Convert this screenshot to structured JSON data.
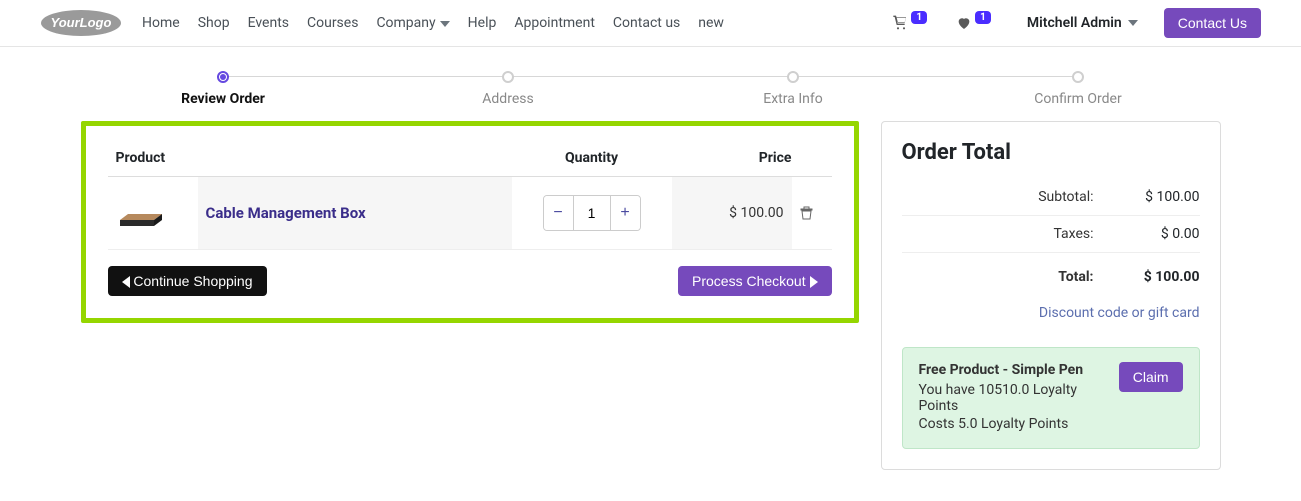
{
  "nav": {
    "items": [
      "Home",
      "Shop",
      "Events",
      "Courses",
      "Company",
      "Help",
      "Appointment",
      "Contact us",
      "new"
    ],
    "dropdown_index": 4,
    "cart_badge": "1",
    "wish_badge": "1",
    "user": "Mitchell Admin",
    "contact_btn": "Contact Us"
  },
  "progress": [
    {
      "label": "Review Order",
      "active": true
    },
    {
      "label": "Address",
      "active": false
    },
    {
      "label": "Extra Info",
      "active": false
    },
    {
      "label": "Confirm Order",
      "active": false
    }
  ],
  "cart": {
    "headers": {
      "product": "Product",
      "quantity": "Quantity",
      "price": "Price"
    },
    "items": [
      {
        "name": "Cable Management Box",
        "qty": "1",
        "price": "$ 100.00"
      }
    ],
    "continue": "Continue Shopping",
    "checkout": "Process Checkout"
  },
  "order": {
    "title": "Order Total",
    "subtotal_label": "Subtotal:",
    "subtotal_val": "$ 100.00",
    "taxes_label": "Taxes:",
    "taxes_val": "$ 0.00",
    "total_label": "Total:",
    "total_val": "$ 100.00",
    "discount_link": "Discount code or gift card"
  },
  "reward": {
    "title": "Free Product - Simple Pen",
    "line1": "You have 10510.0 Loyalty Points",
    "line2": "Costs 5.0 Loyalty Points",
    "claim": "Claim"
  }
}
